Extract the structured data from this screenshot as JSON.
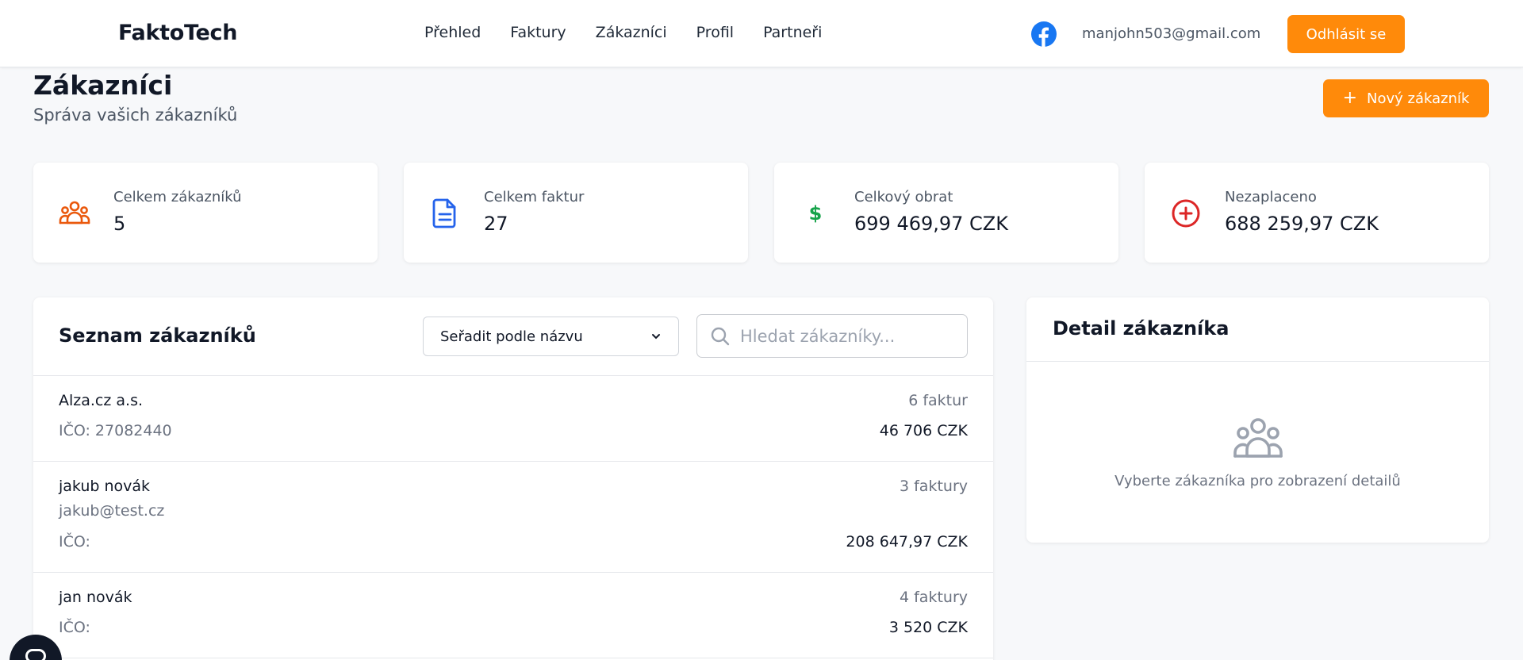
{
  "header": {
    "brand": "FaktoTech",
    "nav": [
      "Přehled",
      "Faktury",
      "Zákazníci",
      "Profil",
      "Partneři"
    ],
    "social_icon": "facebook-icon",
    "user_email": "manjohn503@gmail.com",
    "logout_label": "Odhlásit se"
  },
  "page": {
    "title": "Zákazníci",
    "subtitle": "Správa vašich zákazníků",
    "new_button_label": "Nový zákazník"
  },
  "stats": [
    {
      "label": "Celkem zákazníků",
      "value": "5",
      "icon": "users-icon",
      "color": "#ea580c"
    },
    {
      "label": "Celkem faktur",
      "value": "27",
      "icon": "document-icon",
      "color": "#2563eb"
    },
    {
      "label": "Celkový obrat",
      "value": "699 469,97 CZK",
      "icon": "dollar-icon",
      "color": "#16a34a"
    },
    {
      "label": "Nezaplaceno",
      "value": "688 259,97 CZK",
      "icon": "plus-circle-icon",
      "color": "#dc2626"
    }
  ],
  "customer_list": {
    "title": "Seznam zákazníků",
    "sort_selected": "Seřadit podle názvu",
    "search_placeholder": "Hledat zákazníky...",
    "rows": [
      {
        "name": "Alza.cz a.s.",
        "email": "",
        "ico": "IČO: 27082440",
        "invoices": "6 faktur",
        "amount": "46 706 CZK"
      },
      {
        "name": "jakub novák",
        "email": "jakub@test.cz",
        "ico": "IČO:",
        "invoices": "3 faktury",
        "amount": "208 647,97 CZK"
      },
      {
        "name": "jan novák",
        "email": "",
        "ico": "IČO:",
        "invoices": "4 faktury",
        "amount": "3 520 CZK"
      }
    ]
  },
  "detail": {
    "title": "Detail zákazníka",
    "empty_text": "Vyberte zákazníka pro zobrazení detailů"
  },
  "colors": {
    "accent": "#ff8a0a",
    "background": "#f7f8fa"
  }
}
